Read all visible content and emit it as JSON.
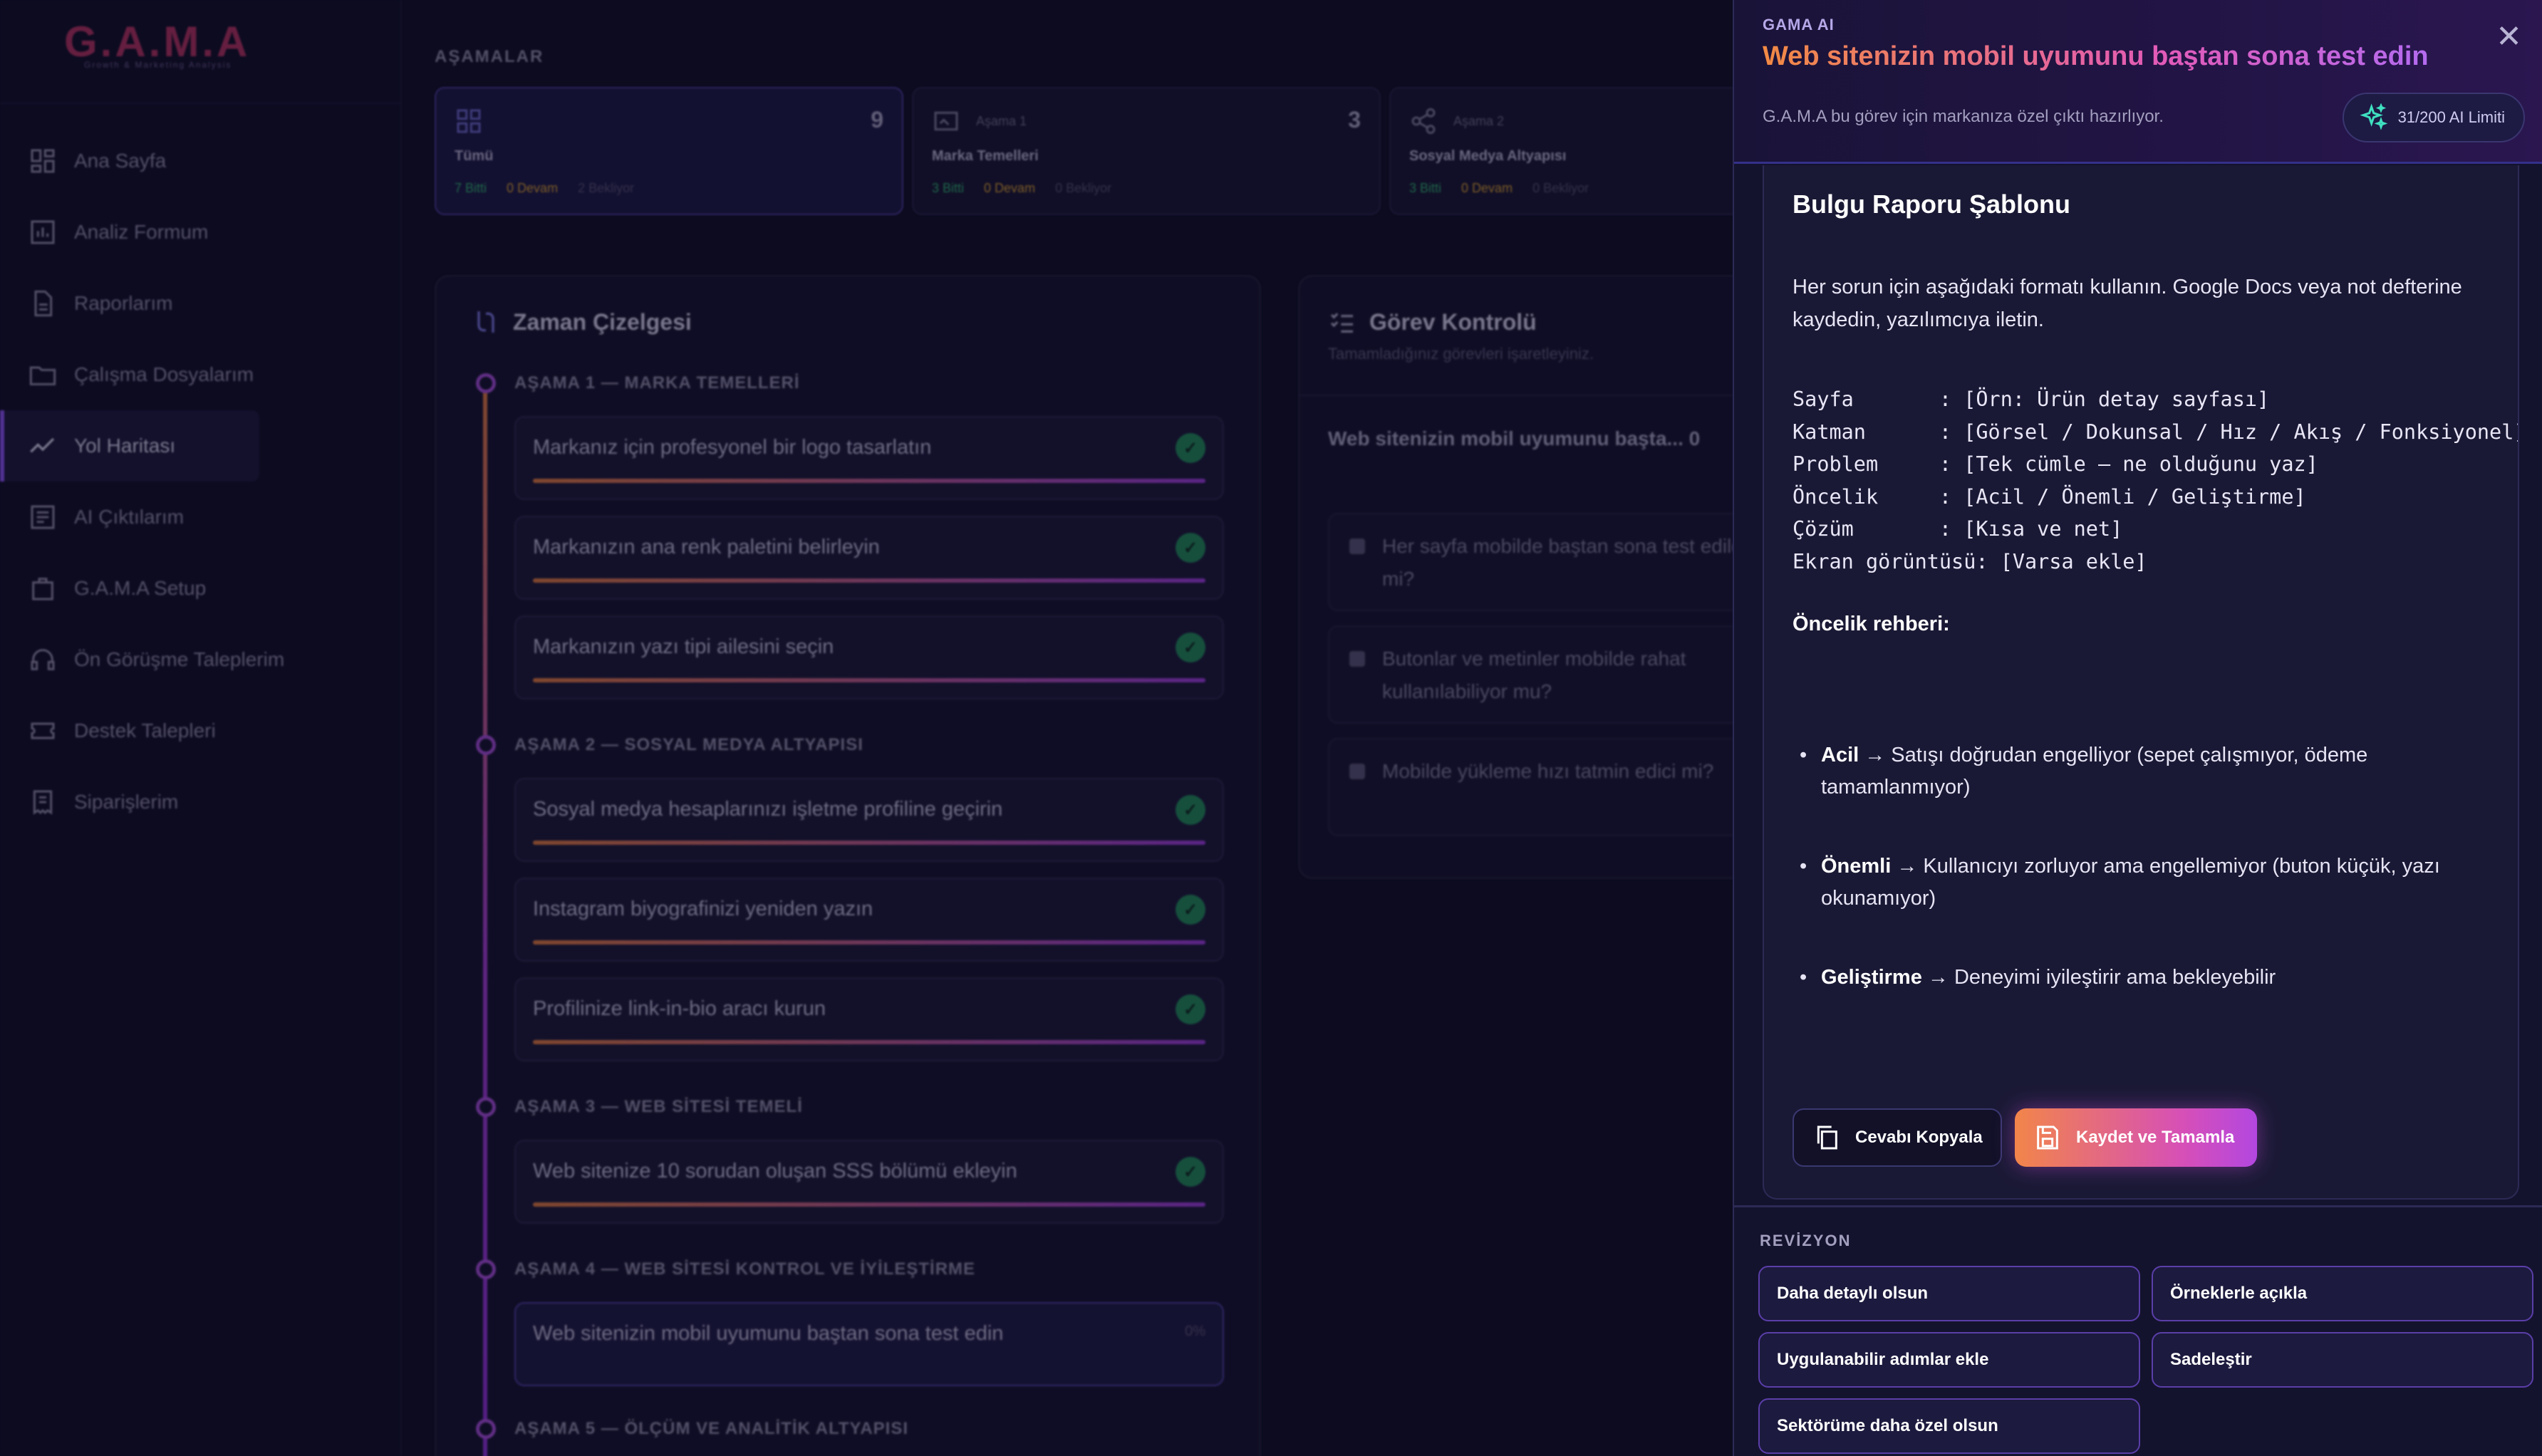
{
  "app": {
    "logo": "G.A.M.A",
    "logo_sub": "Growth & Marketing Analysis"
  },
  "sidebar": {
    "items": [
      {
        "label": "Ana Sayfa",
        "icon": "grid-icon"
      },
      {
        "label": "Analiz Formum",
        "icon": "chart-icon"
      },
      {
        "label": "Raporlarım",
        "icon": "document-icon"
      },
      {
        "label": "Çalışma Dosyalarım",
        "icon": "folder-icon"
      },
      {
        "label": "Yol Haritası",
        "icon": "trend-icon",
        "active": true
      },
      {
        "label": "AI Çıktılarım",
        "icon": "list-icon"
      },
      {
        "label": "G.A.M.A Setup",
        "icon": "bag-icon"
      },
      {
        "label": "Ön Görüşme Taleplerim",
        "icon": "headset-icon"
      },
      {
        "label": "Destek Talepleri",
        "icon": "ticket-icon"
      },
      {
        "label": "Siparişlerim",
        "icon": "receipt-icon"
      }
    ]
  },
  "stages": {
    "title": "AŞAMALAR",
    "cards": [
      {
        "sub": "",
        "name": "Tümü",
        "count": "9",
        "done": "7 Bitti",
        "ongoing": "0 Devam",
        "waiting": "2 Bekliyor"
      },
      {
        "sub": "Aşama 1",
        "name": "Marka Temelleri",
        "count": "3",
        "done": "3 Bitti",
        "ongoing": "0 Devam",
        "waiting": "0 Bekliyor"
      },
      {
        "sub": "Aşama 2",
        "name": "Sosyal Medya Altyapısı",
        "count": "",
        "done": "3 Bitti",
        "ongoing": "0 Devam",
        "waiting": "0 Bekliyor"
      }
    ]
  },
  "timeline": {
    "title": "Zaman Çizelgesi",
    "phases": [
      {
        "label": "AŞAMA 1 — MARKA TEMELLERİ",
        "tasks": [
          "Markanız için profesyonel bir logo tasarlatın",
          "Markanızın ana renk paletini belirleyin",
          "Markanızın yazı tipi ailesini seçin"
        ]
      },
      {
        "label": "AŞAMA 2 — SOSYAL MEDYA ALTYAPISI",
        "tasks": [
          "Sosyal medya hesaplarınızı işletme profiline geçirin",
          "Instagram biyografinizi yeniden yazın",
          "Profilinize link-in-bio aracı kurun"
        ]
      },
      {
        "label": "AŞAMA 3 — WEB SİTESİ TEMELİ",
        "tasks": [
          "Web sitenize 10 sorudan oluşan SSS bölümü ekleyin"
        ]
      },
      {
        "label": "AŞAMA 4 — WEB SİTESİ KONTROL VE İYİLEŞTİRME",
        "tasks": [
          "Web sitenizin mobil uyumunu baştan sona test edin"
        ],
        "current_pct": "0%"
      },
      {
        "label": "AŞAMA 5 — ÖLÇÜM VE ANALİTİK ALTYAPISI",
        "tasks": []
      }
    ]
  },
  "gorev": {
    "title": "Görev Kontrolü",
    "subtitle": "Tamamladığınız görevleri işaretleyiniz.",
    "question": "Web sitenizin mobil uyumunu başta... 0",
    "checks": [
      "Her sayfa mobilde baştan sona test edildi mi?",
      "Butonlar ve metinler mobilde rahat kullanılabiliyor mu?",
      "Mobilde yükleme hızı tatmin edici mi?"
    ]
  },
  "panel": {
    "brand": "GAMA AI",
    "title": "Web sitenizin mobil uyumunu baştan sona test edin",
    "description": "G.A.M.A bu görev için markanıza özel çıktı hazırlıyor.",
    "limit": "31/200 AI Limiti",
    "content_title": "Bulgu Raporu Şablonu",
    "intro": "Her sorun için aşağıdaki formatı kullanın. Google Docs veya not defterine kaydedin, yazılımcıya iletin.",
    "template_lines": [
      "Sayfa       : [Örn: Ürün detay sayfası]",
      "Katman      : [Görsel / Dokunsal / Hız / Akış / Fonksiyonel]",
      "Problem     : [Tek cümle — ne olduğunu yaz]",
      "Öncelik     : [Acil / Önemli / Geliştirme]",
      "Çözüm       : [Kısa ve net]",
      "Ekran görüntüsü: [Varsa ekle]"
    ],
    "priority_heading": "Öncelik rehberi:",
    "priorities": [
      {
        "term": "Acil",
        "text": " → Satışı doğrudan engelliyor (sepet çalışmıyor, ödeme tamamlanmıyor)"
      },
      {
        "term": "Önemli",
        "text": " → Kullanıcıyı zorluyor ama engellemiyor (buton küçük, yazı okunamıyor)"
      },
      {
        "term": "Geliştirme",
        "text": " → Deneyimi iyileştirir ama bekleyebilir"
      }
    ],
    "copy_button": "Cevabı Kopyala",
    "save_button": "Kaydet ve Tamamla"
  },
  "revision": {
    "label": "REVİZYON",
    "options": [
      "Daha detaylı olsun",
      "Örneklerle açıkla",
      "Uygulanabilir adımlar ekle",
      "Sadeleştir",
      "Sektörüme daha özel olsun"
    ]
  },
  "colors": {
    "accent": "#8a52f0",
    "gradient_start": "#f2854a",
    "gradient_end": "#b347e0",
    "done_green": "#2fb36c"
  }
}
